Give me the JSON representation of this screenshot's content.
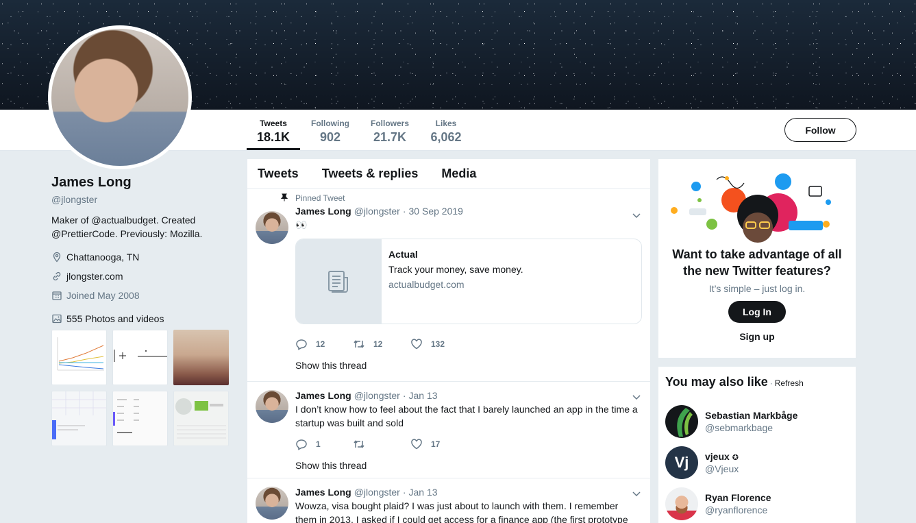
{
  "profile": {
    "name": "James Long",
    "handle": "@jlongster",
    "bio": "Maker of @actualbudget. Created @PrettierCode. Previously: Mozilla.",
    "location": "Chattanooga, TN",
    "website": "jlongster.com",
    "joined": "Joined May 2008",
    "photos_label": "555 Photos and videos"
  },
  "stats": [
    {
      "label": "Tweets",
      "value": "18.1K"
    },
    {
      "label": "Following",
      "value": "902"
    },
    {
      "label": "Followers",
      "value": "21.7K"
    },
    {
      "label": "Likes",
      "value": "6,062"
    }
  ],
  "follow_label": "Follow",
  "tabs": [
    "Tweets",
    "Tweets & replies",
    "Media"
  ],
  "tweets": [
    {
      "pinned_label": "Pinned Tweet",
      "name": "James Long",
      "handle": "@jlongster",
      "date": "30 Sep 2019",
      "text": "👀",
      "card": {
        "title": "Actual",
        "desc": "Track your money, save money.",
        "url": "actualbudget.com"
      },
      "replies": "12",
      "retweets": "12",
      "likes": "132",
      "thread_label": "Show this thread"
    },
    {
      "name": "James Long",
      "handle": "@jlongster",
      "date": "Jan 13",
      "text": "I don’t know how to feel about the fact that I barely launched an app in the time a startup was built and sold",
      "replies": "1",
      "retweets": "",
      "likes": "17",
      "thread_label": "Show this thread"
    },
    {
      "name": "James Long",
      "handle": "@jlongster",
      "date": "Jan 13",
      "text": "Wowza, visa bought plaid? I was just about to launch with them. I remember them in 2013, I asked if I could get access for a finance app (the first prototype"
    }
  ],
  "promo": {
    "title": "Want to take advantage of all the new Twitter features?",
    "subtitle": "It’s simple – just log in.",
    "login_label": "Log In",
    "signup_label": "Sign up"
  },
  "who_to_follow": {
    "title": "You may also like",
    "dot": "·",
    "refresh": "Refresh",
    "users": [
      {
        "name": "Sebastian Markbåge",
        "handle": "@sebmarkbage"
      },
      {
        "name": "vjeux",
        "handle": "@Vjeux",
        "avatar_text": "Vj"
      },
      {
        "name": "Ryan Florence",
        "handle": "@ryanflorence"
      }
    ]
  },
  "colors": {
    "text_primary": "#14171a",
    "text_secondary": "#657786",
    "page_bg": "#e6ecf0",
    "divider": "#e1e8ed"
  }
}
